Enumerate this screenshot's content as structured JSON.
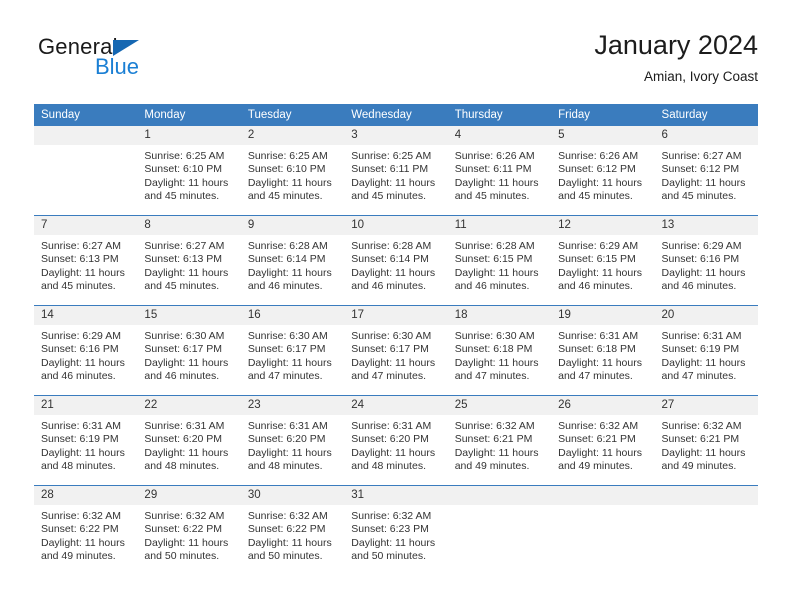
{
  "brand": {
    "name_part1": "General",
    "name_part2": "Blue",
    "triangle_color": "#1567b2",
    "blue_color": "#1a7fd4"
  },
  "header": {
    "title": "January 2024",
    "subtitle": "Amian, Ivory Coast"
  },
  "theme": {
    "header_blue": "#3a7cbe",
    "daynum_bg": "#f1f1f1",
    "text": "#333333"
  },
  "weekday_headers": [
    "Sunday",
    "Monday",
    "Tuesday",
    "Wednesday",
    "Thursday",
    "Friday",
    "Saturday"
  ],
  "labels": {
    "sunrise_prefix": "Sunrise:",
    "sunset_prefix": "Sunset:",
    "daylight_prefix": "Daylight:"
  },
  "weeks": [
    [
      {
        "day": "",
        "blank": true,
        "sunrise": "",
        "sunset": "",
        "daylight_line1": "",
        "daylight_line2": ""
      },
      {
        "day": "1",
        "sunrise": "Sunrise: 6:25 AM",
        "sunset": "Sunset: 6:10 PM",
        "daylight_line1": "Daylight: 11 hours",
        "daylight_line2": "and 45 minutes."
      },
      {
        "day": "2",
        "sunrise": "Sunrise: 6:25 AM",
        "sunset": "Sunset: 6:10 PM",
        "daylight_line1": "Daylight: 11 hours",
        "daylight_line2": "and 45 minutes."
      },
      {
        "day": "3",
        "sunrise": "Sunrise: 6:25 AM",
        "sunset": "Sunset: 6:11 PM",
        "daylight_line1": "Daylight: 11 hours",
        "daylight_line2": "and 45 minutes."
      },
      {
        "day": "4",
        "sunrise": "Sunrise: 6:26 AM",
        "sunset": "Sunset: 6:11 PM",
        "daylight_line1": "Daylight: 11 hours",
        "daylight_line2": "and 45 minutes."
      },
      {
        "day": "5",
        "sunrise": "Sunrise: 6:26 AM",
        "sunset": "Sunset: 6:12 PM",
        "daylight_line1": "Daylight: 11 hours",
        "daylight_line2": "and 45 minutes."
      },
      {
        "day": "6",
        "sunrise": "Sunrise: 6:27 AM",
        "sunset": "Sunset: 6:12 PM",
        "daylight_line1": "Daylight: 11 hours",
        "daylight_line2": "and 45 minutes."
      }
    ],
    [
      {
        "day": "7",
        "sunrise": "Sunrise: 6:27 AM",
        "sunset": "Sunset: 6:13 PM",
        "daylight_line1": "Daylight: 11 hours",
        "daylight_line2": "and 45 minutes."
      },
      {
        "day": "8",
        "sunrise": "Sunrise: 6:27 AM",
        "sunset": "Sunset: 6:13 PM",
        "daylight_line1": "Daylight: 11 hours",
        "daylight_line2": "and 45 minutes."
      },
      {
        "day": "9",
        "sunrise": "Sunrise: 6:28 AM",
        "sunset": "Sunset: 6:14 PM",
        "daylight_line1": "Daylight: 11 hours",
        "daylight_line2": "and 46 minutes."
      },
      {
        "day": "10",
        "sunrise": "Sunrise: 6:28 AM",
        "sunset": "Sunset: 6:14 PM",
        "daylight_line1": "Daylight: 11 hours",
        "daylight_line2": "and 46 minutes."
      },
      {
        "day": "11",
        "sunrise": "Sunrise: 6:28 AM",
        "sunset": "Sunset: 6:15 PM",
        "daylight_line1": "Daylight: 11 hours",
        "daylight_line2": "and 46 minutes."
      },
      {
        "day": "12",
        "sunrise": "Sunrise: 6:29 AM",
        "sunset": "Sunset: 6:15 PM",
        "daylight_line1": "Daylight: 11 hours",
        "daylight_line2": "and 46 minutes."
      },
      {
        "day": "13",
        "sunrise": "Sunrise: 6:29 AM",
        "sunset": "Sunset: 6:16 PM",
        "daylight_line1": "Daylight: 11 hours",
        "daylight_line2": "and 46 minutes."
      }
    ],
    [
      {
        "day": "14",
        "sunrise": "Sunrise: 6:29 AM",
        "sunset": "Sunset: 6:16 PM",
        "daylight_line1": "Daylight: 11 hours",
        "daylight_line2": "and 46 minutes."
      },
      {
        "day": "15",
        "sunrise": "Sunrise: 6:30 AM",
        "sunset": "Sunset: 6:17 PM",
        "daylight_line1": "Daylight: 11 hours",
        "daylight_line2": "and 46 minutes."
      },
      {
        "day": "16",
        "sunrise": "Sunrise: 6:30 AM",
        "sunset": "Sunset: 6:17 PM",
        "daylight_line1": "Daylight: 11 hours",
        "daylight_line2": "and 47 minutes."
      },
      {
        "day": "17",
        "sunrise": "Sunrise: 6:30 AM",
        "sunset": "Sunset: 6:17 PM",
        "daylight_line1": "Daylight: 11 hours",
        "daylight_line2": "and 47 minutes."
      },
      {
        "day": "18",
        "sunrise": "Sunrise: 6:30 AM",
        "sunset": "Sunset: 6:18 PM",
        "daylight_line1": "Daylight: 11 hours",
        "daylight_line2": "and 47 minutes."
      },
      {
        "day": "19",
        "sunrise": "Sunrise: 6:31 AM",
        "sunset": "Sunset: 6:18 PM",
        "daylight_line1": "Daylight: 11 hours",
        "daylight_line2": "and 47 minutes."
      },
      {
        "day": "20",
        "sunrise": "Sunrise: 6:31 AM",
        "sunset": "Sunset: 6:19 PM",
        "daylight_line1": "Daylight: 11 hours",
        "daylight_line2": "and 47 minutes."
      }
    ],
    [
      {
        "day": "21",
        "sunrise": "Sunrise: 6:31 AM",
        "sunset": "Sunset: 6:19 PM",
        "daylight_line1": "Daylight: 11 hours",
        "daylight_line2": "and 48 minutes."
      },
      {
        "day": "22",
        "sunrise": "Sunrise: 6:31 AM",
        "sunset": "Sunset: 6:20 PM",
        "daylight_line1": "Daylight: 11 hours",
        "daylight_line2": "and 48 minutes."
      },
      {
        "day": "23",
        "sunrise": "Sunrise: 6:31 AM",
        "sunset": "Sunset: 6:20 PM",
        "daylight_line1": "Daylight: 11 hours",
        "daylight_line2": "and 48 minutes."
      },
      {
        "day": "24",
        "sunrise": "Sunrise: 6:31 AM",
        "sunset": "Sunset: 6:20 PM",
        "daylight_line1": "Daylight: 11 hours",
        "daylight_line2": "and 48 minutes."
      },
      {
        "day": "25",
        "sunrise": "Sunrise: 6:32 AM",
        "sunset": "Sunset: 6:21 PM",
        "daylight_line1": "Daylight: 11 hours",
        "daylight_line2": "and 49 minutes."
      },
      {
        "day": "26",
        "sunrise": "Sunrise: 6:32 AM",
        "sunset": "Sunset: 6:21 PM",
        "daylight_line1": "Daylight: 11 hours",
        "daylight_line2": "and 49 minutes."
      },
      {
        "day": "27",
        "sunrise": "Sunrise: 6:32 AM",
        "sunset": "Sunset: 6:21 PM",
        "daylight_line1": "Daylight: 11 hours",
        "daylight_line2": "and 49 minutes."
      }
    ],
    [
      {
        "day": "28",
        "sunrise": "Sunrise: 6:32 AM",
        "sunset": "Sunset: 6:22 PM",
        "daylight_line1": "Daylight: 11 hours",
        "daylight_line2": "and 49 minutes."
      },
      {
        "day": "29",
        "sunrise": "Sunrise: 6:32 AM",
        "sunset": "Sunset: 6:22 PM",
        "daylight_line1": "Daylight: 11 hours",
        "daylight_line2": "and 50 minutes."
      },
      {
        "day": "30",
        "sunrise": "Sunrise: 6:32 AM",
        "sunset": "Sunset: 6:22 PM",
        "daylight_line1": "Daylight: 11 hours",
        "daylight_line2": "and 50 minutes."
      },
      {
        "day": "31",
        "sunrise": "Sunrise: 6:32 AM",
        "sunset": "Sunset: 6:23 PM",
        "daylight_line1": "Daylight: 11 hours",
        "daylight_line2": "and 50 minutes."
      },
      {
        "day": "",
        "blank": true,
        "sunrise": "",
        "sunset": "",
        "daylight_line1": "",
        "daylight_line2": ""
      },
      {
        "day": "",
        "blank": true,
        "sunrise": "",
        "sunset": "",
        "daylight_line1": "",
        "daylight_line2": ""
      },
      {
        "day": "",
        "blank": true,
        "sunrise": "",
        "sunset": "",
        "daylight_line1": "",
        "daylight_line2": ""
      }
    ]
  ]
}
